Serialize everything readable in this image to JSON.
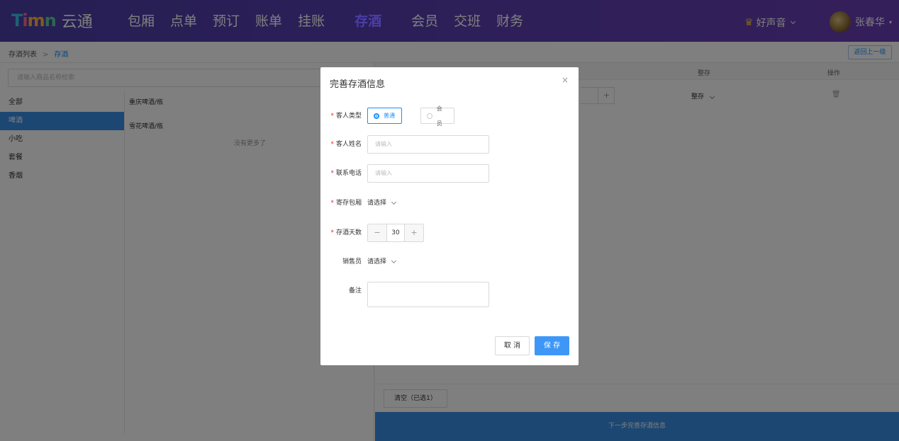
{
  "header": {
    "logo_mark": [
      "T",
      "i",
      "m",
      "n"
    ],
    "logo_text": "云通",
    "nav": [
      "包厢",
      "点单",
      "预订",
      "账单",
      "挂账",
      "存酒",
      "会员",
      "交班",
      "财务"
    ],
    "nav_active": "存酒",
    "store_name": "好声音",
    "user_name": "张春华"
  },
  "breadcrumb": {
    "parent": "存酒列表",
    "separator": ">",
    "current": "存酒"
  },
  "back_button": "返回上一级",
  "left": {
    "search_placeholder": "请输入商品名称检索",
    "categories": [
      "全部",
      "啤酒",
      "小吃",
      "套餐",
      "香烟"
    ],
    "active_category": "啤酒",
    "products": [
      "重庆啤酒/瓶",
      "雪花啤酒/瓶"
    ],
    "no_more": "没有更多了"
  },
  "right": {
    "columns": [
      "整存",
      "操作"
    ],
    "row_store": "整存",
    "clear_button": "清空（已选1）",
    "next_button": "下一步完善存酒信息"
  },
  "modal": {
    "title": "完善存酒信息",
    "close": "×",
    "customer_type_label": "客人类型",
    "customer_type_options": [
      "普通",
      "会员"
    ],
    "customer_type_selected": "普通",
    "name_label": "客人姓名",
    "name_placeholder": "请输入",
    "phone_label": "联系电话",
    "phone_placeholder": "请输入",
    "room_label": "寄存包厢",
    "room_value": "请选择",
    "days_label": "存酒天数",
    "days_value": "30",
    "sales_label": "销售员",
    "sales_value": "请选择",
    "remark_label": "备注",
    "cancel": "取 消",
    "save": "保 存"
  },
  "colors": {
    "header_start": "#4b3ea8",
    "header_end": "#6a3fb5",
    "primary": "#1890ff",
    "active_category": "#3a8ee6"
  }
}
